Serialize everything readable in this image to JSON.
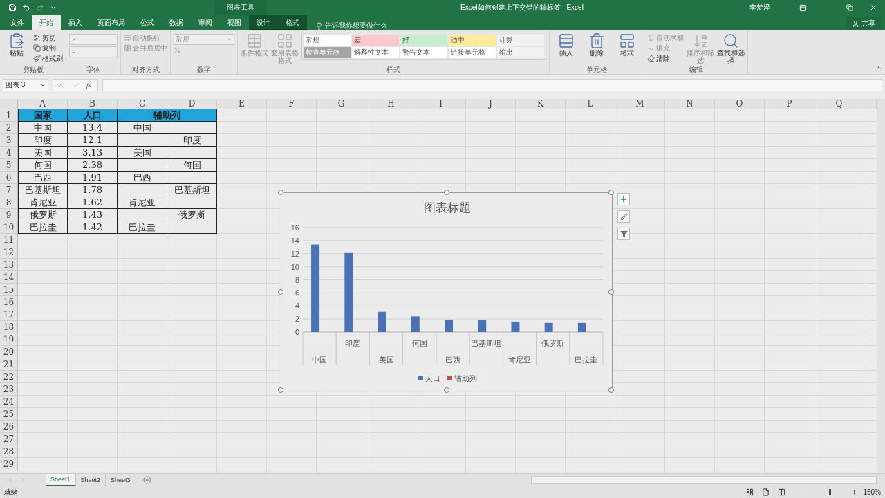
{
  "title_bar": {
    "contextual_group": "图表工具",
    "title": "Excel如何创建上下交错的轴标签 - Excel",
    "user": "李梦泽"
  },
  "tabs": [
    {
      "label": "文件",
      "selected": false,
      "contextual": false
    },
    {
      "label": "开始",
      "selected": true,
      "contextual": false
    },
    {
      "label": "插入",
      "selected": false,
      "contextual": false
    },
    {
      "label": "页面布局",
      "selected": false,
      "contextual": false
    },
    {
      "label": "公式",
      "selected": false,
      "contextual": false
    },
    {
      "label": "数据",
      "selected": false,
      "contextual": false
    },
    {
      "label": "审阅",
      "selected": false,
      "contextual": false
    },
    {
      "label": "视图",
      "selected": false,
      "contextual": false
    },
    {
      "label": "设计",
      "selected": false,
      "contextual": true
    },
    {
      "label": "格式",
      "selected": false,
      "contextual": true
    }
  ],
  "tell_me": "告诉我你想要做什么",
  "share": "共享",
  "ribbon": {
    "groups": [
      {
        "label": "剪贴板",
        "items": [
          {
            "kind": "large",
            "label": "粘贴",
            "disabled": false
          },
          {
            "kind": "small",
            "label": "剪切",
            "disabled": false
          },
          {
            "kind": "small",
            "label": "复制",
            "disabled": false
          },
          {
            "kind": "small",
            "label": "格式刷",
            "disabled": false
          }
        ]
      },
      {
        "label": "字体",
        "items": [
          {
            "kind": "field",
            "disabled": true
          },
          {
            "kind": "field",
            "disabled": true
          }
        ]
      },
      {
        "label": "对齐方式",
        "items": [
          {
            "kind": "small",
            "label": "自动换行",
            "disabled": true
          },
          {
            "kind": "small",
            "label": "合并后居中",
            "disabled": true
          }
        ]
      },
      {
        "label": "数字",
        "items": [
          {
            "kind": "field",
            "label": "常规",
            "disabled": true
          },
          {
            "kind": "tools",
            "disabled": true
          }
        ]
      },
      {
        "label": "样式",
        "items": [
          {
            "kind": "large",
            "label": "条件格式",
            "disabled": true
          },
          {
            "kind": "large",
            "label": "套用表格格式",
            "disabled": true
          },
          {
            "kind": "gallery",
            "disabled": true,
            "styles": [
              {
                "label": "常规",
                "color": "#ffffff"
              },
              {
                "label": "差",
                "color": "#ffc7ce"
              },
              {
                "label": "好",
                "color": "#c6efce"
              },
              {
                "label": "适中",
                "color": "#ffeb9c"
              },
              {
                "label": "计算",
                "color": "#f2f2f2"
              },
              {
                "label": "检查单元格",
                "color": "#a5a5a5"
              },
              {
                "label": "解释性文本",
                "color": "#ffffff"
              },
              {
                "label": "警告文本",
                "color": "#ffffff"
              },
              {
                "label": "链接单元格",
                "color": "#ffffff"
              },
              {
                "label": "输出",
                "color": "#f2f2f2"
              }
            ]
          }
        ]
      },
      {
        "label": "单元格",
        "items": [
          {
            "kind": "large",
            "label": "插入",
            "disabled": false
          },
          {
            "kind": "large",
            "label": "删除",
            "disabled": false
          },
          {
            "kind": "large",
            "label": "格式",
            "disabled": false
          }
        ]
      },
      {
        "label": "编辑",
        "items": [
          {
            "kind": "small",
            "label": "自动求和",
            "disabled": true
          },
          {
            "kind": "small",
            "label": "填充",
            "disabled": true
          },
          {
            "kind": "small",
            "label": "清除",
            "disabled": false
          },
          {
            "kind": "large",
            "label": "排序和筛选",
            "disabled": true
          },
          {
            "kind": "large",
            "label": "查找和选择",
            "disabled": false
          }
        ]
      }
    ]
  },
  "formula_bar": {
    "name_box": "图表 3",
    "function_label": "fx"
  },
  "sheet": {
    "columns": [
      "A",
      "B",
      "C",
      "D",
      "E",
      "F",
      "G",
      "H",
      "I",
      "J",
      "K",
      "L",
      "M",
      "N",
      "O",
      "P",
      "Q"
    ],
    "row_headers": [
      "1",
      "2",
      "3",
      "4",
      "5",
      "6",
      "7",
      "8",
      "9",
      "10",
      "11",
      "12",
      "13",
      "14",
      "15",
      "16",
      "17",
      "18",
      "19",
      "20",
      "21",
      "22",
      "23",
      "24",
      "25",
      "26",
      "27",
      "28",
      "29"
    ],
    "header": [
      {
        "text": "国家",
        "merged": false
      },
      {
        "text": "人口",
        "merged": false
      },
      {
        "text": "辅助列",
        "merged": true
      }
    ],
    "rows": [
      [
        "中国",
        "13.4",
        "中国",
        null
      ],
      [
        "印度",
        "12.1",
        null,
        "印度"
      ],
      [
        "美国",
        "3.13",
        "美国",
        null
      ],
      [
        "何国",
        "2.38",
        null,
        "何国"
      ],
      [
        "巴西",
        "1.91",
        "巴西",
        null
      ],
      [
        "巴基斯坦",
        "1.78",
        null,
        "巴基斯坦"
      ],
      [
        "肯尼亚",
        "1.62",
        "肯尼亚",
        null
      ],
      [
        "俄罗斯",
        "1.43",
        null,
        "俄罗斯"
      ],
      [
        "巴拉圭",
        "1.42",
        "巴拉圭",
        null
      ]
    ]
  },
  "chart": {
    "selected": true,
    "chart_data": {
      "type": "bar",
      "title": "图表标题",
      "categories": [
        "中国",
        "印度",
        "美国",
        "何国",
        "巴西",
        "巴基斯坦",
        "肯尼亚",
        "俄罗斯",
        "巴拉圭"
      ],
      "series": [
        {
          "name": "人口",
          "color": "#4a72b5",
          "values": [
            13.4,
            12.1,
            3.1,
            2.4,
            1.9,
            1.8,
            1.6,
            1.4,
            1.4
          ]
        },
        {
          "name": "辅助列",
          "color": "#c0504d",
          "values": [
            null,
            null,
            null,
            null,
            null,
            null,
            null,
            null,
            null
          ]
        }
      ],
      "ylim": [
        0,
        16
      ],
      "yticks": [
        0,
        2,
        4,
        6,
        8,
        10,
        12,
        14,
        16
      ],
      "grid": true
    }
  },
  "sheet_tabs": [
    {
      "label": "Sheet1",
      "selected": true
    },
    {
      "label": "Sheet2",
      "selected": false
    },
    {
      "label": "Sheet3",
      "selected": false
    }
  ],
  "status_bar": {
    "status": "就绪",
    "zoom": "150%",
    "zoom_slider": {
      "level": 0.6
    }
  }
}
